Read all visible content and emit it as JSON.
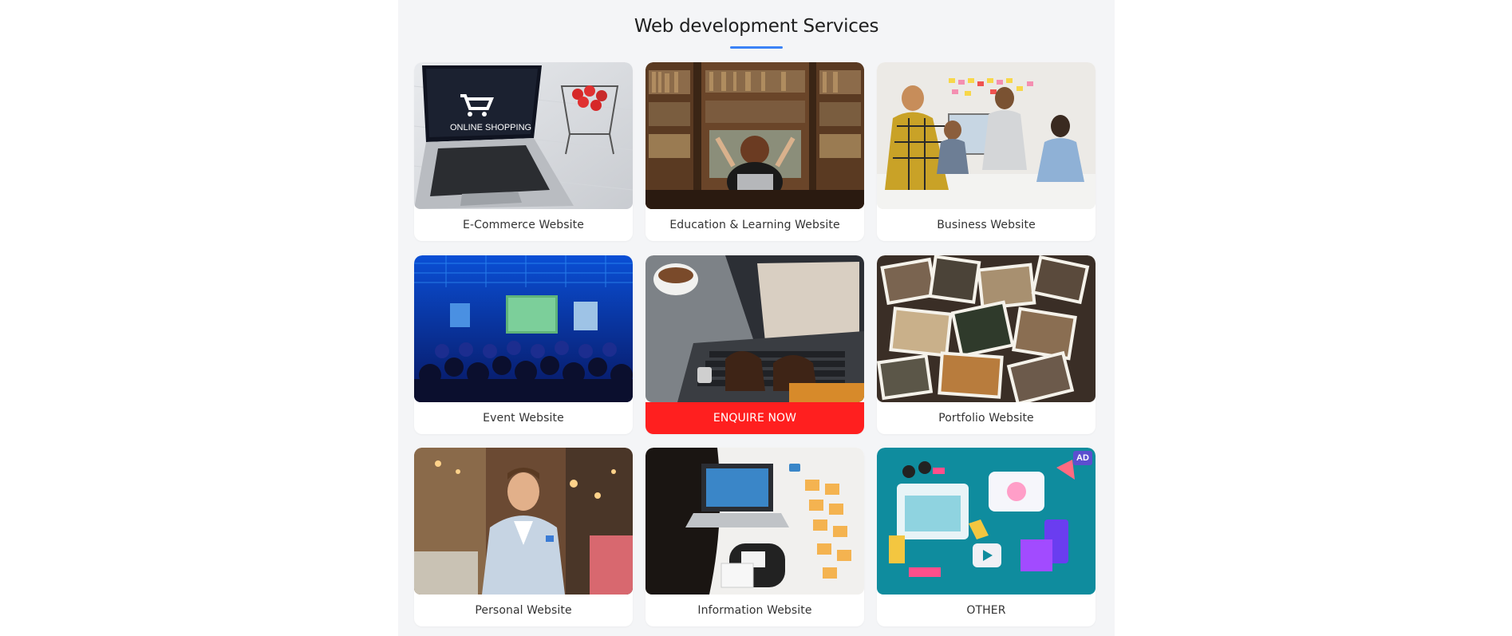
{
  "section": {
    "title": "Web development Services",
    "accent_color": "#3b82f6"
  },
  "cards": [
    {
      "label": "E-Commerce Website",
      "image": "laptop-online-shopping-image",
      "overlay_text": "ONLINE SHOPPING"
    },
    {
      "label": "Education & Learning Website",
      "image": "library-student-image"
    },
    {
      "label": "Business Website",
      "image": "business-meeting-image"
    },
    {
      "label": "Event Website",
      "image": "conference-audience-image"
    },
    {
      "label": "ENQUIRE NOW",
      "image": "typing-laptop-image",
      "highlight_color": "#ff1f1f"
    },
    {
      "label": "Portfolio Website",
      "image": "photo-collage-image"
    },
    {
      "label": "Personal Website",
      "image": "man-portrait-restaurant-image"
    },
    {
      "label": "Information Website",
      "image": "desk-workspace-image"
    },
    {
      "label": "OTHER",
      "image": "digital-marketing-illustration-image",
      "badge": "AD"
    }
  ]
}
